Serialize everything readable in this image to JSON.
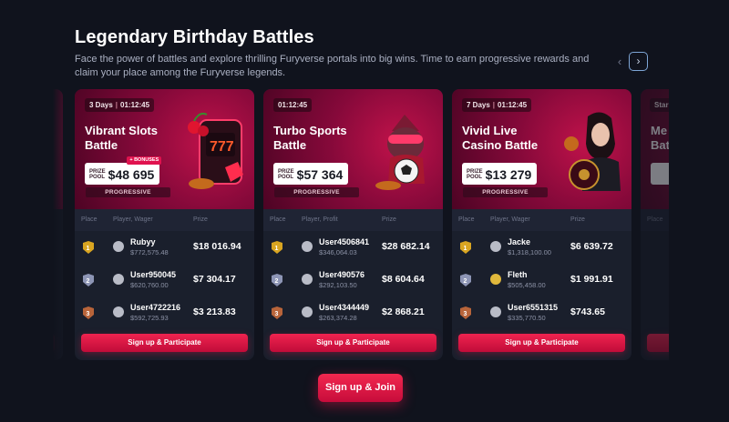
{
  "page": {
    "title": "Legendary Birthday Battles",
    "description": "Face the power of battles and explore thrilling Furyverse portals into big wins. Time to earn progressive rewards and claim your place among the Furyverse legends.",
    "prev_icon": "chevron-left-icon",
    "next_icon": "chevron-right-icon",
    "join_label": "Sign up & Join"
  },
  "cards": [
    {
      "days": "3 Days",
      "time": "01:12:45",
      "name_line1": "Vibrant Slots",
      "name_line2": "Battle",
      "pool_label_1": "PRIZE",
      "pool_label_2": "POOL",
      "pool_value": "$48 695",
      "bonus": "+ BONUSES",
      "progressive": "PROGRESSIVE",
      "col_place": "Place",
      "col_player": "Player, Wager",
      "col_prize": "Prize",
      "rows": [
        {
          "name": "Rubyy",
          "amount": "$772,575.48",
          "prize": "$18 016.94"
        },
        {
          "name": "User950045",
          "amount": "$620,760.00",
          "prize": "$7 304.17"
        },
        {
          "name": "User4722216",
          "amount": "$592,725.93",
          "prize": "$3 213.83"
        }
      ],
      "cta": "Sign up & Participate",
      "art_icon": "slot-machine-icon"
    },
    {
      "days": "",
      "time": "01:12:45",
      "name_line1": "Turbo Sports",
      "name_line2": "Battle",
      "pool_label_1": "PRIZE",
      "pool_label_2": "POOL",
      "pool_value": "$57 364",
      "bonus": "",
      "progressive": "PROGRESSIVE",
      "col_place": "Place",
      "col_player": "Player, Profit",
      "col_prize": "Prize",
      "rows": [
        {
          "name": "User4506841",
          "amount": "$346,064.03",
          "prize": "$28 682.14"
        },
        {
          "name": "User490576",
          "amount": "$292,103.50",
          "prize": "$8 604.64"
        },
        {
          "name": "User4344449",
          "amount": "$263,374.28",
          "prize": "$2 868.21"
        }
      ],
      "cta": "Sign up & Participate",
      "art_icon": "soccer-ball-icon"
    },
    {
      "days": "7 Days",
      "time": "01:12:45",
      "name_line1": "Vivid Live",
      "name_line2": "Casino Battle",
      "pool_label_1": "PRIZE",
      "pool_label_2": "POOL",
      "pool_value": "$13 279",
      "bonus": "",
      "progressive": "PROGRESSIVE",
      "col_place": "Place",
      "col_player": "Player, Wager",
      "col_prize": "Prize",
      "rows": [
        {
          "name": "Jacke",
          "amount": "$1,318,100.00",
          "prize": "$6 639.72"
        },
        {
          "name": "Fleth",
          "amount": "$505,458.00",
          "prize": "$1 991.91"
        },
        {
          "name": "User6551315",
          "amount": "$335,770.50",
          "prize": "$743.65"
        }
      ],
      "cta": "Sign up & Participate",
      "art_icon": "roulette-wheel-icon"
    }
  ],
  "partial_right": {
    "timer_prefix": "Star",
    "name_line1": "Me",
    "name_line2": "Bat",
    "col_place": "Place"
  },
  "colors": {
    "accent": "#e0124e",
    "background": "#10131d",
    "card": "#1a1f2c"
  }
}
